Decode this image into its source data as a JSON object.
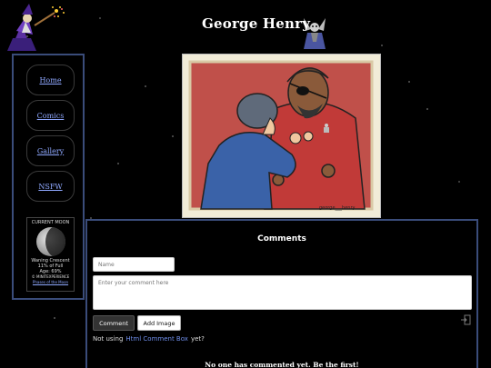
{
  "header": {
    "title": "George Henry"
  },
  "nav": {
    "items": [
      {
        "label": "Home"
      },
      {
        "label": "Comics"
      },
      {
        "label": "Gallery"
      },
      {
        "label": "NSFW"
      }
    ]
  },
  "moon": {
    "heading": "CURRENT MOON",
    "phase": "Waning Crescent",
    "illumination": "11% of Full",
    "age": "Age: 69%",
    "credit": "© MINITEXPERIENCE",
    "link": "Phases of the Moon"
  },
  "comic": {
    "signature": "george___henry"
  },
  "comments": {
    "title": "Comments",
    "name_placeholder": "Name",
    "comment_placeholder": "Enter your comment here",
    "comment_button": "Comment",
    "add_image_button": "Add Image",
    "not_using_prefix": "Not using",
    "not_using_link": "Html Comment Box",
    "not_using_suffix": "yet?",
    "empty_message": "No one has commented yet. Be the first!"
  },
  "colors": {
    "accent_border": "#3a4c7a",
    "link": "#8fa8ff",
    "comic_bg": "#f1ecd8"
  }
}
